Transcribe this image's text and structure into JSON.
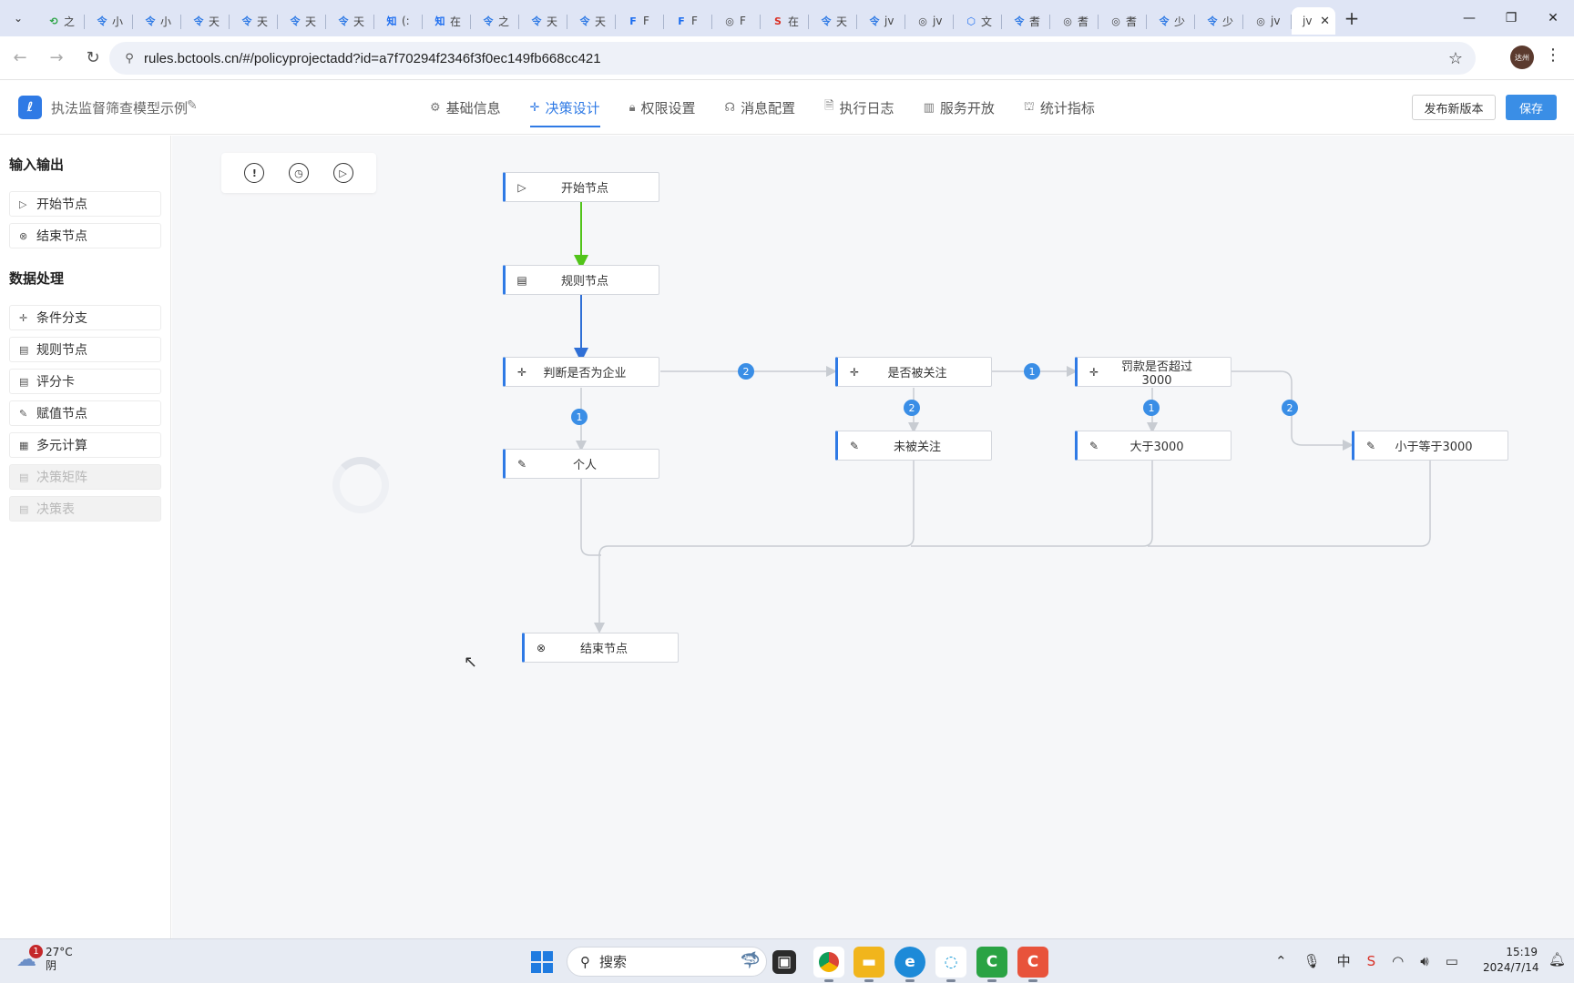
{
  "browser": {
    "tabs": [
      {
        "glyph": "⟲",
        "text": "之",
        "color": "#2aa344"
      },
      {
        "glyph": "令",
        "text": "小",
        "color": "#2f7ae5"
      },
      {
        "glyph": "令",
        "text": "小",
        "color": "#2f7ae5"
      },
      {
        "glyph": "令",
        "text": "天",
        "color": "#2f7ae5"
      },
      {
        "glyph": "令",
        "text": "天",
        "color": "#2f7ae5"
      },
      {
        "glyph": "令",
        "text": "天",
        "color": "#2f7ae5"
      },
      {
        "glyph": "令",
        "text": "天",
        "color": "#2f7ae5"
      },
      {
        "glyph": "知",
        "text": "(:",
        "color": "#1a6cf0"
      },
      {
        "glyph": "知",
        "text": "在",
        "color": "#1a6cf0"
      },
      {
        "glyph": "令",
        "text": "之",
        "color": "#2f7ae5"
      },
      {
        "glyph": "令",
        "text": "天",
        "color": "#2f7ae5"
      },
      {
        "glyph": "令",
        "text": "天",
        "color": "#2f7ae5"
      },
      {
        "glyph": "F",
        "text": "F",
        "color": "#1a6cf0"
      },
      {
        "glyph": "F",
        "text": "F",
        "color": "#1a6cf0"
      },
      {
        "glyph": "◎",
        "text": "F",
        "color": "#444444"
      },
      {
        "glyph": "S",
        "text": "在",
        "color": "#d93025"
      },
      {
        "glyph": "令",
        "text": "天",
        "color": "#2f7ae5"
      },
      {
        "glyph": "令",
        "text": "jv",
        "color": "#2f7ae5"
      },
      {
        "glyph": "◎",
        "text": "jv",
        "color": "#444444"
      },
      {
        "glyph": "⬡",
        "text": "文",
        "color": "#1a6cf0"
      },
      {
        "glyph": "令",
        "text": "耆",
        "color": "#2f7ae5"
      },
      {
        "glyph": "◎",
        "text": "耆",
        "color": "#444444"
      },
      {
        "glyph": "◎",
        "text": "耆",
        "color": "#444444"
      },
      {
        "glyph": "令",
        "text": "少",
        "color": "#2f7ae5"
      },
      {
        "glyph": "令",
        "text": "少",
        "color": "#2f7ae5"
      },
      {
        "glyph": "◎",
        "text": "jv",
        "color": "#444444"
      }
    ],
    "active_tab": "jv",
    "url": "rules.bctools.cn/#/policyprojectadd?id=a7f70294f2346f3f0ec149fb668cc421",
    "profile_label": "达州"
  },
  "app": {
    "title": "执法监督筛查模型示例",
    "nav": [
      {
        "label": "基础信息",
        "icon": "gear-icon",
        "glyph": "⚙"
      },
      {
        "label": "决策设计",
        "icon": "move-icon",
        "glyph": "✛"
      },
      {
        "label": "权限设置",
        "icon": "lock-icon",
        "glyph": "🔒︎"
      },
      {
        "label": "消息配置",
        "icon": "headset-icon",
        "glyph": "☊"
      },
      {
        "label": "执行日志",
        "icon": "document-icon",
        "glyph": "🗎"
      },
      {
        "label": "服务开放",
        "icon": "book-icon",
        "glyph": "▥"
      },
      {
        "label": "统计指标",
        "icon": "chart-icon",
        "glyph": "⛫"
      }
    ],
    "active_nav": "决策设计",
    "publish_label": "发布新版本",
    "save_label": "保存",
    "accent_color": "#2f7ae5"
  },
  "sidebar": {
    "section_io": "输入输出",
    "io_items": [
      {
        "label": "开始节点",
        "glyph": "▷"
      },
      {
        "label": "结束节点",
        "glyph": "⊗"
      }
    ],
    "section_data": "数据处理",
    "data_items": [
      {
        "label": "条件分支",
        "glyph": "✛",
        "disabled": false
      },
      {
        "label": "规则节点",
        "glyph": "▤",
        "disabled": false
      },
      {
        "label": "评分卡",
        "glyph": "▤",
        "disabled": false
      },
      {
        "label": "赋值节点",
        "glyph": "✎",
        "disabled": false
      },
      {
        "label": "多元计算",
        "glyph": "▦",
        "disabled": false
      },
      {
        "label": "决策矩阵",
        "glyph": "▤",
        "disabled": true
      },
      {
        "label": "决策表",
        "glyph": "▤",
        "disabled": true
      }
    ]
  },
  "canvas": {
    "nodes": {
      "start": {
        "label": "开始节点",
        "icon": "play-circle-icon",
        "glyph": "▷"
      },
      "rule": {
        "label": "规则节点",
        "icon": "card-icon",
        "glyph": "▤"
      },
      "judge": {
        "label": "判断是否为企业",
        "icon": "branch-icon",
        "glyph": "✛"
      },
      "person": {
        "label": "个人",
        "icon": "edit-icon",
        "glyph": "✎"
      },
      "followed": {
        "label": "是否被关注",
        "icon": "branch-icon",
        "glyph": "✛"
      },
      "not_followed": {
        "label": "未被关注",
        "icon": "edit-icon",
        "glyph": "✎"
      },
      "fine": {
        "label": "罚款是否超过3000",
        "icon": "branch-icon",
        "glyph": "✛"
      },
      "gt3000": {
        "label": "大于3000",
        "icon": "edit-icon",
        "glyph": "✎"
      },
      "le3000": {
        "label": "小于等于3000",
        "icon": "edit-icon",
        "glyph": "✎"
      },
      "end": {
        "label": "结束节点",
        "icon": "close-circle-icon",
        "glyph": "⊗"
      }
    },
    "badges": [
      "2",
      "1",
      "1",
      "2",
      "1",
      "2"
    ],
    "edge_colors": {
      "start_to_rule": "#52c41a",
      "rule_to_judge": "#2f6fd6",
      "default": "#c8ccd2"
    }
  },
  "taskbar": {
    "temperature": "27°C",
    "weather_text": "阴",
    "weather_badge": "1",
    "search_placeholder": "搜索",
    "time": "15:19",
    "date": "2024/7/14",
    "input_method": "中"
  }
}
